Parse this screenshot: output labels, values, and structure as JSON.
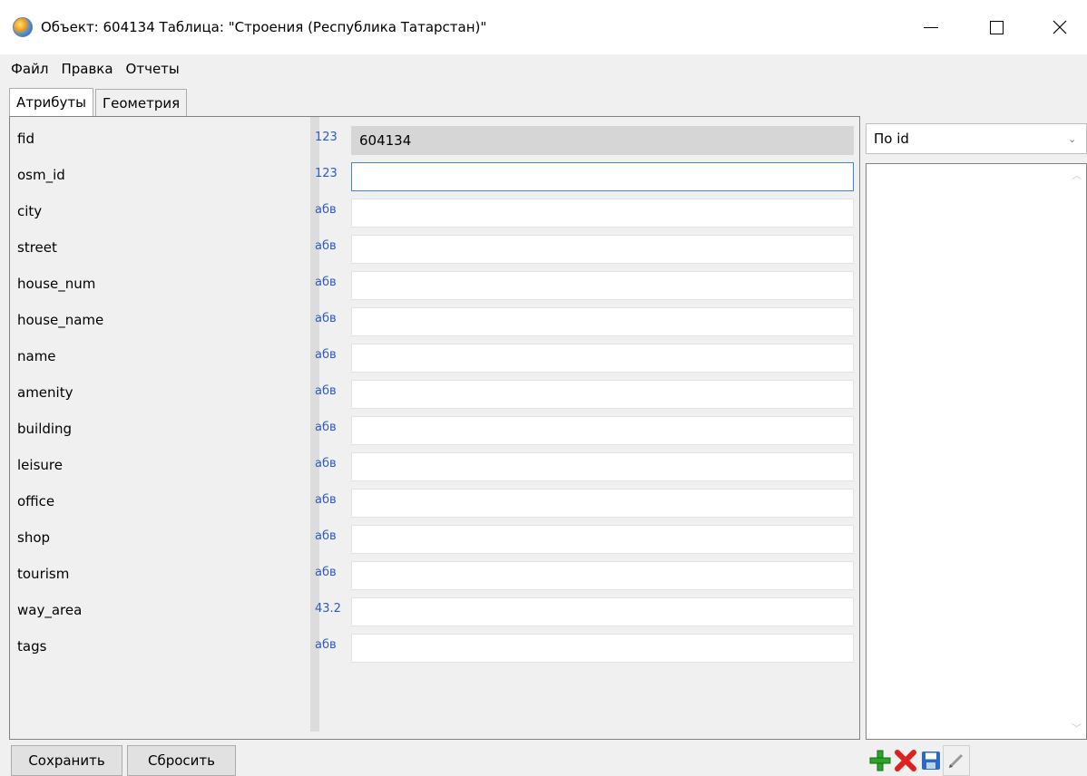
{
  "window": {
    "title": "Объект: 604134 Таблица: \"Строения (Республика Татарстан)\""
  },
  "menu": [
    "Файл",
    "Правка",
    "Отчеты"
  ],
  "tabs": [
    {
      "label": "Атрибуты",
      "active": true
    },
    {
      "label": "Геометрия",
      "active": false
    }
  ],
  "attributes": [
    {
      "name": "fid",
      "type": "123",
      "value": "604134",
      "readonly": true
    },
    {
      "name": "osm_id",
      "type": "123",
      "value": "",
      "focused": true
    },
    {
      "name": "city",
      "type": "абв",
      "value": ""
    },
    {
      "name": "street",
      "type": "абв",
      "value": ""
    },
    {
      "name": "house_num",
      "type": "абв",
      "value": ""
    },
    {
      "name": "house_name",
      "type": "абв",
      "value": ""
    },
    {
      "name": "name",
      "type": "абв",
      "value": ""
    },
    {
      "name": "amenity",
      "type": "абв",
      "value": ""
    },
    {
      "name": "building",
      "type": "абв",
      "value": ""
    },
    {
      "name": "leisure",
      "type": "абв",
      "value": ""
    },
    {
      "name": "office",
      "type": "абв",
      "value": ""
    },
    {
      "name": "shop",
      "type": "абв",
      "value": ""
    },
    {
      "name": "tourism",
      "type": "абв",
      "value": ""
    },
    {
      "name": "way_area",
      "type": "43.2",
      "value": ""
    },
    {
      "name": "tags",
      "type": "абв",
      "value": ""
    }
  ],
  "side": {
    "sort_combo": "По id"
  },
  "buttons": {
    "save": "Сохранить",
    "reset": "Сбросить"
  },
  "toolbar_icons": [
    "add-icon",
    "delete-icon",
    "save-icon",
    "edit-icon"
  ],
  "colors": {
    "type_label": "#2b5bc4",
    "add": "#2aa52a",
    "delete": "#e0201c",
    "save": "#2a6ac4"
  }
}
